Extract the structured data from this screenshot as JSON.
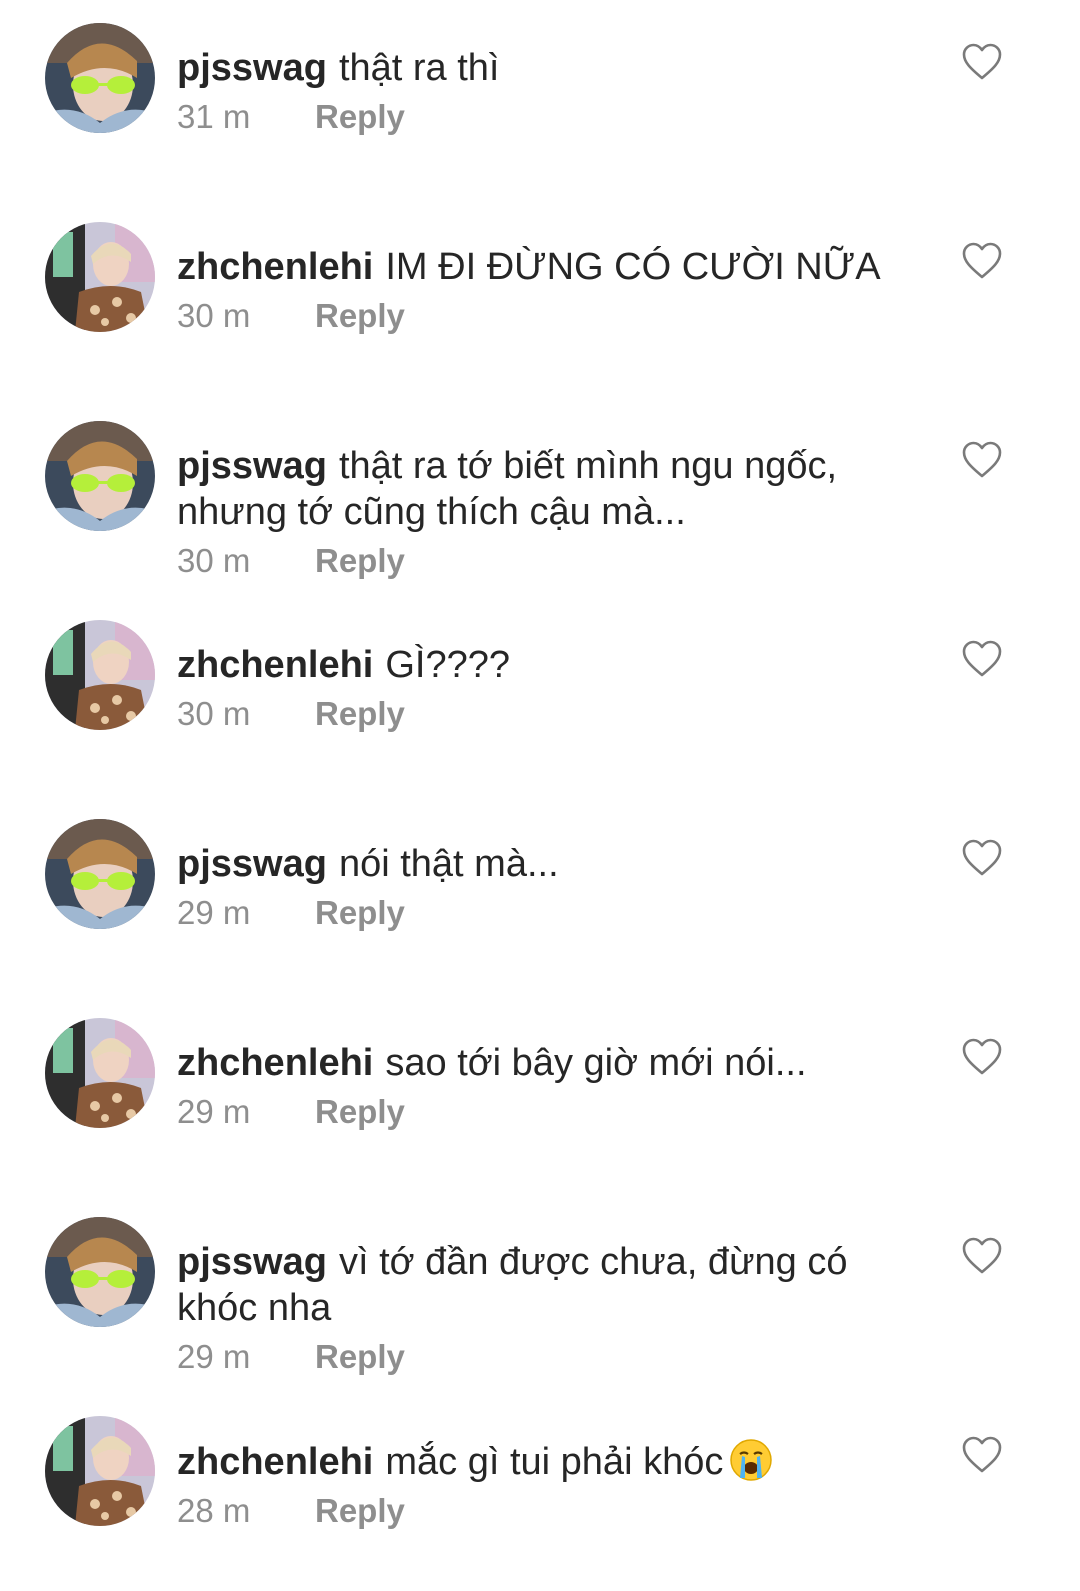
{
  "comments": [
    {
      "user": "pjsswag",
      "text": "thật ra thì",
      "time": "31 m",
      "reply": "Reply",
      "avatar": "pjsswag-avatar"
    },
    {
      "user": "zhchenlehi",
      "text": "IM ĐI ĐỪNG CÓ CƯỜI NỮA",
      "time": "30 m",
      "reply": "Reply",
      "avatar": "zhchenlehi-avatar"
    },
    {
      "user": "pjsswag",
      "text": "thật ra tớ biết mình ngu ngốc, nhưng tớ cũng thích cậu mà...",
      "time": "30 m",
      "reply": "Reply",
      "avatar": "pjsswag-avatar"
    },
    {
      "user": "zhchenlehi",
      "text": "GÌ????",
      "time": "30 m",
      "reply": "Reply",
      "avatar": "zhchenlehi-avatar"
    },
    {
      "user": "pjsswag",
      "text": "nói thật mà...",
      "time": "29 m",
      "reply": "Reply",
      "avatar": "pjsswag-avatar"
    },
    {
      "user": "zhchenlehi",
      "text": "sao tới bây giờ mới nói...",
      "time": "29 m",
      "reply": "Reply",
      "avatar": "zhchenlehi-avatar"
    },
    {
      "user": "pjsswag",
      "text": "vì tớ đần được chưa, đừng có khóc nha",
      "time": "29 m",
      "reply": "Reply",
      "avatar": "pjsswag-avatar"
    },
    {
      "user": "zhchenlehi",
      "text": "mắc gì tui phải khóc",
      "time": "28 m",
      "reply": "Reply",
      "avatar": "zhchenlehi-avatar",
      "emoji": "crying-face-emoji"
    }
  ],
  "icons": {
    "like": "heart-outline-icon"
  },
  "colors": {
    "text": "#262626",
    "meta": "#8e8e8e",
    "background": "#ffffff"
  }
}
